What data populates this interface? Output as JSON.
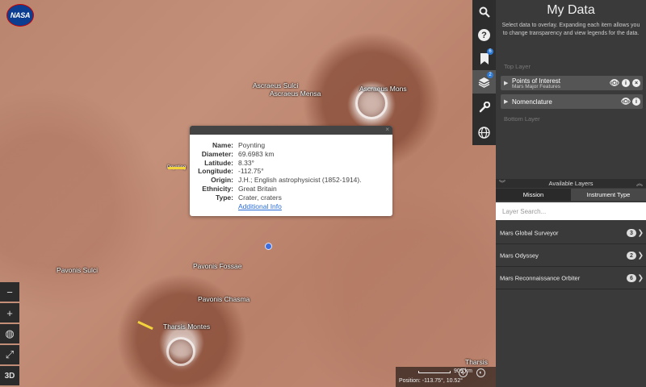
{
  "map": {
    "logo": "NASA",
    "labels": [
      "Ascraeus Sulci",
      "Ascraeus Mensa",
      "Ascraeus Mons",
      "Poynting",
      "Pavonis Sulci",
      "Pavonis Fossae",
      "Pavonis Chasma",
      "Tharsis Montes",
      "Tharsis"
    ]
  },
  "popup": {
    "rows": [
      {
        "key": "Name:",
        "value": "Poynting"
      },
      {
        "key": "Diameter:",
        "value": "69.6983 km"
      },
      {
        "key": "Latitude:",
        "value": "8.33°"
      },
      {
        "key": "Longitude:",
        "value": "-112.75°"
      },
      {
        "key": "Origin:",
        "value": "J.H.; English astrophysicist (1852-1914)."
      },
      {
        "key": "Ethnicity:",
        "value": "Great Britain"
      },
      {
        "key": "Type:",
        "value": "Crater, craters"
      }
    ],
    "link": "Additional Info",
    "close": "×"
  },
  "left_toolbar": {
    "zoom_out": "−",
    "zoom_in": "+",
    "globe": "◍",
    "fullscreen": "⤢",
    "view_3d": "3D"
  },
  "scale": {
    "value": "909 km",
    "position": "Position: -113.75°, 10.52°"
  },
  "right_toolbar": {
    "layers_badge": "2",
    "bookmarks_badge": "6"
  },
  "panel": {
    "title": "My Data",
    "description": "Select data to overlay. Expanding each item allows you to change transparency and view legends for the data.",
    "top_layer_label": "Top Layer",
    "bottom_layer_label": "Bottom Layer",
    "layers": [
      {
        "name": "Points of Interest",
        "sub": "Mars Major Features"
      },
      {
        "name": "Nomenclature",
        "sub": ""
      }
    ],
    "available_title": "Available Layers",
    "tabs": [
      "Mission",
      "Instrument Type"
    ],
    "search_placeholder": "Layer Search...",
    "missions": [
      {
        "name": "Mars Global Surveyor",
        "count": "3"
      },
      {
        "name": "Mars Odyssey",
        "count": "2"
      },
      {
        "name": "Mars Reconnaissance Orbiter",
        "count": "6"
      }
    ]
  }
}
